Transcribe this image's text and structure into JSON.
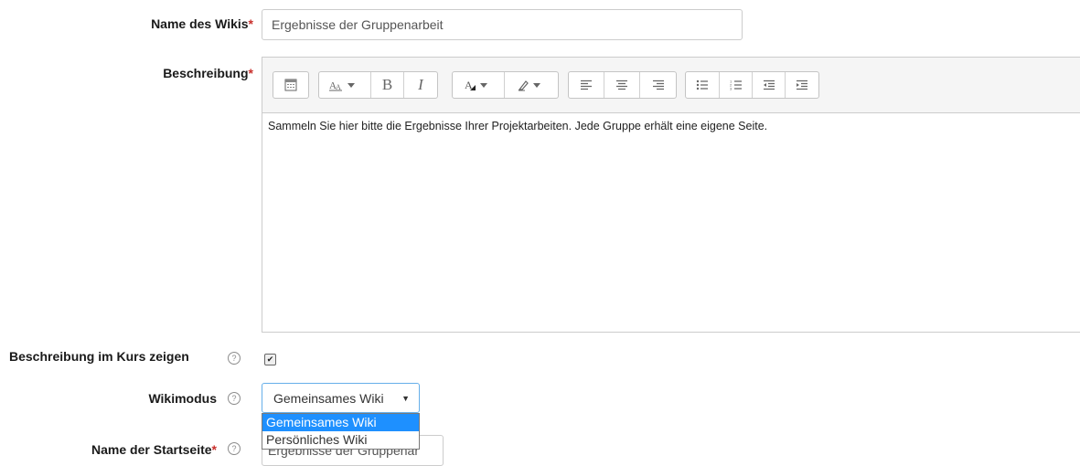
{
  "fields": {
    "name": {
      "label": "Name des Wikis",
      "required_mark": "*",
      "value": "Ergebnisse der Gruppenarbeit"
    },
    "description": {
      "label": "Beschreibung",
      "required_mark": "*",
      "text": "Sammeln Sie hier bitte die Ergebnisse Ihrer Projektarbeiten. Jede Gruppe erhält eine eigene Seite."
    },
    "show_description": {
      "label": "Beschreibung im Kurs zeigen",
      "checked": true,
      "check_glyph": "✔"
    },
    "wikimode": {
      "label": "Wikimodus",
      "value": "Gemeinsames Wiki",
      "options": [
        "Gemeinsames Wiki",
        "Persönliches Wiki"
      ]
    },
    "start_page": {
      "label": "Name der Startseite",
      "required_mark": "*",
      "value": "Ergebnisse der Gruppenar"
    }
  },
  "help_glyph": "?",
  "toolbar": {
    "groups": [
      [
        "toolbar-toggle-icon"
      ],
      [
        "font-style-icon",
        "bold-icon",
        "italic-icon"
      ],
      [
        "text-color-icon",
        "background-color-icon"
      ],
      [
        "align-left-icon",
        "align-center-icon",
        "align-right-icon"
      ],
      [
        "bullet-list-icon",
        "numbered-list-icon",
        "outdent-icon",
        "indent-icon"
      ]
    ],
    "bold_glyph": "B",
    "italic_glyph": "I"
  },
  "colors": {
    "accent": "#1e90ff",
    "required": "#c9302c",
    "focus_border": "#66afe9"
  }
}
